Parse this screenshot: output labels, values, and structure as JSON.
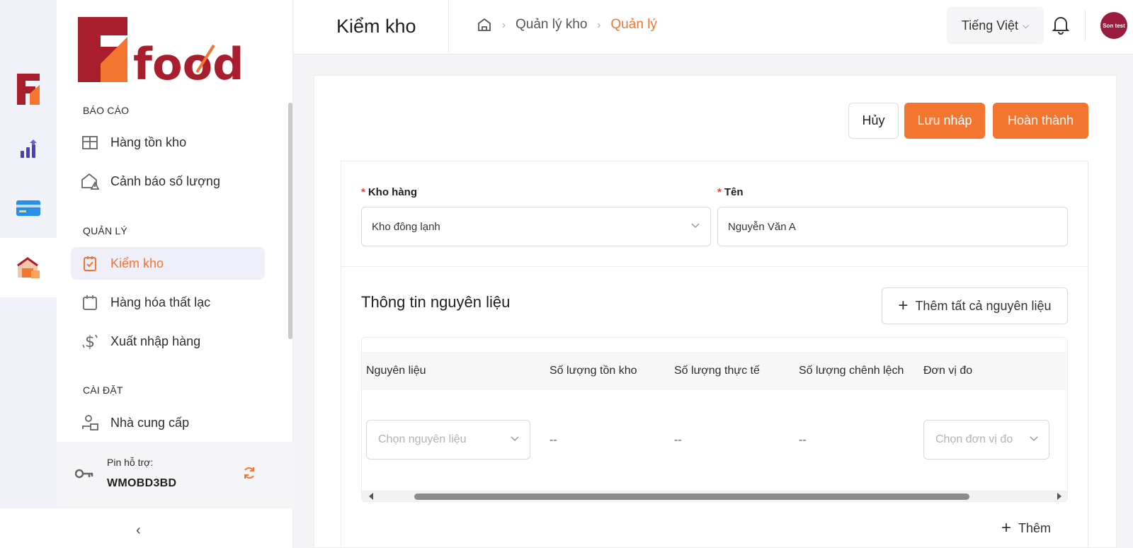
{
  "brand": {
    "name": "Food",
    "accent": "#f47530",
    "dark_red": "#a81e2d"
  },
  "rail": {
    "items": [
      {
        "name": "brand-icon"
      },
      {
        "name": "report-chart-icon"
      },
      {
        "name": "payment-card-icon"
      },
      {
        "name": "warehouse-icon",
        "active": true
      }
    ]
  },
  "sidebar": {
    "sections": [
      {
        "title": "BÁO CÁO",
        "items": [
          {
            "label": "Hàng tồn kho"
          },
          {
            "label": "Cảnh báo số lượng"
          }
        ]
      },
      {
        "title": "QUẢN LÝ",
        "items": [
          {
            "label": "Kiểm kho",
            "active": true
          },
          {
            "label": "Hàng hóa thất lạc"
          },
          {
            "label": "Xuất nhập hàng"
          }
        ]
      },
      {
        "title": "CÀI ĐẶT",
        "items": [
          {
            "label": "Nhà cung cấp"
          }
        ]
      }
    ],
    "pin_label": "Pin hỗ trợ:",
    "pin_code": "WMOBD3BD"
  },
  "header": {
    "title": "Kiểm kho",
    "breadcrumb": [
      "Quản lý kho",
      "Quản lý"
    ],
    "language": "Tiếng Việt",
    "avatar_text": "Son test"
  },
  "actions": {
    "cancel": "Hủy",
    "save_draft": "Lưu nháp",
    "complete": "Hoàn thành"
  },
  "form": {
    "warehouse": {
      "label": "Kho hàng",
      "value": "Kho đông lạnh"
    },
    "name": {
      "label": "Tên",
      "value": "Nguyễn Văn A"
    }
  },
  "materials": {
    "title": "Thông tin nguyên liệu",
    "add_all": "Thêm tất cả nguyên liệu",
    "columns": [
      "Nguyên liệu",
      "Số lượng tồn kho",
      "Số lượng thực tế",
      "Số lượng chênh lệch",
      "Đơn vị đo"
    ],
    "row": {
      "material_placeholder": "Chọn nguyên liệu",
      "stock": "--",
      "actual": "--",
      "diff": "--",
      "unit_placeholder": "Chọn đơn vị đo"
    },
    "add": "Thêm"
  }
}
